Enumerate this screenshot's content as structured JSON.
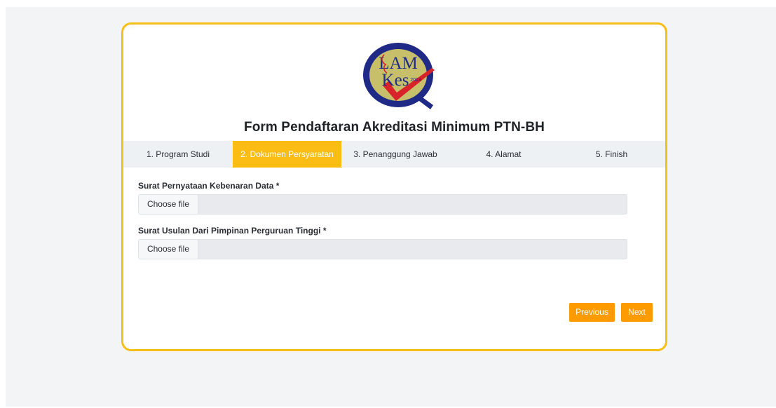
{
  "form": {
    "title": "Form Pendaftaran Akreditasi Minimum PTN-BH",
    "logo": {
      "line1": "LAM",
      "line2": "Kes",
      "year": "2014",
      "colors": {
        "ring": "#1f2a86",
        "disc": "#c8bf6a",
        "text": "#1e2c8c",
        "check": "#d8232a"
      }
    }
  },
  "steps": [
    {
      "label": "1. Program Studi",
      "active": false
    },
    {
      "label": "2. Dokumen Persyaratan",
      "active": true
    },
    {
      "label": "3. Penanggung Jawab",
      "active": false
    },
    {
      "label": "4. Alamat",
      "active": false
    },
    {
      "label": "5. Finish",
      "active": false
    }
  ],
  "fields": [
    {
      "label": "Surat Pernyataan Kebenaran Data *",
      "button": "Choose file",
      "value": ""
    },
    {
      "label": "Surat Usulan Dari Pimpinan Perguruan Tinggi *",
      "button": "Choose file",
      "value": ""
    }
  ],
  "buttons": {
    "previous": "Previous",
    "next": "Next"
  },
  "colors": {
    "accent": "#fbbd14",
    "border": "#f7bd18",
    "button": "#fd9b00"
  }
}
